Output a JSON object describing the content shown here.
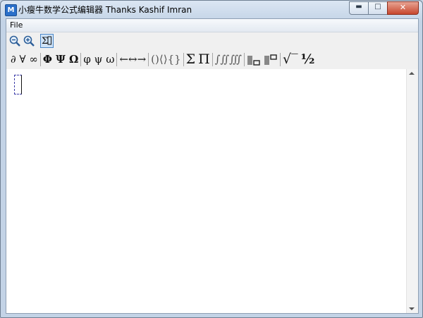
{
  "window": {
    "title": "小瘦牛数学公式编辑器 Thanks Kashif Imran",
    "app_icon_letter": "M"
  },
  "caption": {
    "minimize": "▬",
    "maximize": "□",
    "close": "✕"
  },
  "menu": {
    "file": "File"
  },
  "zoom": {
    "zoom_out_icon": "zoom-out-icon",
    "zoom_in_icon": "zoom-in-icon",
    "formula_icon": "sigma-box-icon",
    "formula_glyph": "Σ"
  },
  "symbols": {
    "operators": "∂ ∀ ∞",
    "greek_upper": "Φ Ψ Ω",
    "greek_lower": "φ ψ ω",
    "arrows": "←↔→",
    "brackets": "()⟨⟩{}",
    "sum": "Σ",
    "product": "Π",
    "integrals": "∫∬∭",
    "sqrt": "√‾",
    "fraction": "½"
  }
}
